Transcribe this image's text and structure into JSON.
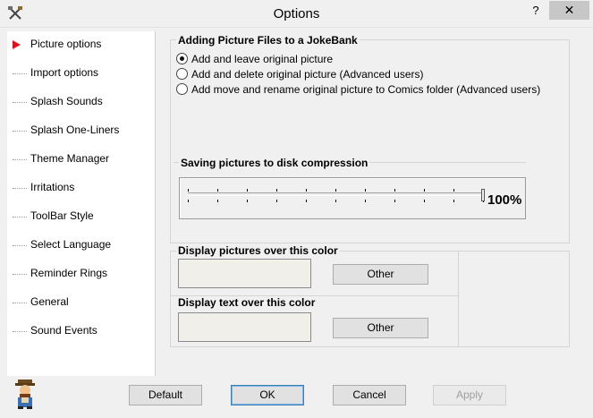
{
  "window": {
    "title": "Options",
    "help_label": "?",
    "close_label": "✕"
  },
  "sidebar": {
    "items": [
      {
        "label": "Picture options",
        "selected": true
      },
      {
        "label": "Import options"
      },
      {
        "label": "Splash Sounds"
      },
      {
        "label": "Splash One-Liners"
      },
      {
        "label": "Theme Manager"
      },
      {
        "label": "Irritations"
      },
      {
        "label": "ToolBar Style"
      },
      {
        "label": "Select Language"
      },
      {
        "label": "Reminder Rings"
      },
      {
        "label": "General"
      },
      {
        "label": "Sound Events"
      }
    ]
  },
  "adding": {
    "title": "Adding Picture Files to a JokeBank",
    "options": [
      {
        "label": "Add and leave original picture",
        "checked": true
      },
      {
        "label": "Add and delete original picture (Advanced users)",
        "checked": false
      },
      {
        "label": "Add move and rename original picture to Comics folder (Advanced users)",
        "checked": false
      }
    ]
  },
  "compression": {
    "title": "Saving pictures to disk compression",
    "value": "100%",
    "level_percent": 100
  },
  "display_pictures": {
    "title": "Display pictures over this color",
    "button": "Other",
    "color": "#f0efe9"
  },
  "display_text": {
    "title": "Display text over this color",
    "button": "Other",
    "color": "#f0efe9"
  },
  "footer": {
    "default_label": "Default",
    "ok_label": "OK",
    "cancel_label": "Cancel",
    "apply_label": "Apply"
  },
  "colors": {
    "selected_marker": "#d9141e",
    "window_bg": "#f0f0f0"
  }
}
